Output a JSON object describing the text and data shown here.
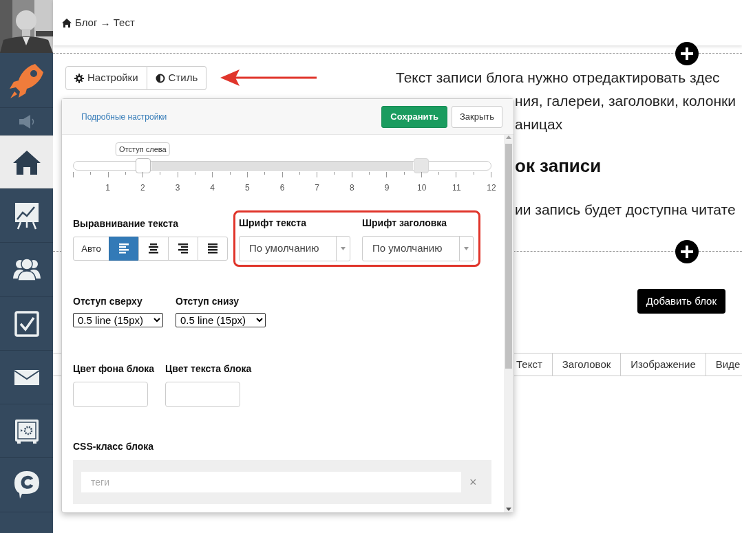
{
  "sidebar": {
    "items": [
      {
        "kind": "rocket",
        "selected": false
      },
      {
        "kind": "speaker",
        "selected": false
      },
      {
        "kind": "home",
        "selected": true
      },
      {
        "kind": "chart",
        "selected": false
      },
      {
        "kind": "people",
        "selected": false
      },
      {
        "kind": "checkbox",
        "selected": false
      },
      {
        "kind": "mail",
        "selected": false
      },
      {
        "kind": "safe",
        "selected": false
      },
      {
        "kind": "chat",
        "selected": false
      }
    ]
  },
  "breadcrumb": "Блог → Тест",
  "toolbar": {
    "buttons": [
      {
        "kind": "settings",
        "label": "Настройки"
      },
      {
        "kind": "style",
        "label": "Стиль"
      }
    ]
  },
  "content": {
    "lines": [
      "Текст записи блога нужно отредактировать здес",
      "ния, галереи, заголовки, колонки",
      "аницах"
    ],
    "heading": "ок записи",
    "paragraph": "ии запись будет доступна читате",
    "add_block_button": "Добавить блок",
    "block_types": [
      "Текст",
      "Заголовок",
      "Изображение",
      "Виде"
    ]
  },
  "popup": {
    "link": "Подробные настройки",
    "save_button": "Сохранить",
    "close_button": "Закрыть",
    "slider": {
      "tooltip": "Отступ слева",
      "ticks": [
        "1",
        "2",
        "3",
        "4",
        "5",
        "6",
        "7",
        "8",
        "9",
        "10",
        "11",
        "12"
      ],
      "thumbs": [
        {
          "level": 0.1667
        },
        {
          "level": 0.8333
        }
      ]
    },
    "alignment": {
      "label": "Выравнивание текста",
      "options": [
        {
          "kind": "auto",
          "label": "Авто",
          "selected": false
        },
        {
          "kind": "left",
          "selected": true
        },
        {
          "kind": "center",
          "selected": false
        },
        {
          "kind": "right",
          "selected": false
        },
        {
          "kind": "justify",
          "selected": false
        }
      ]
    },
    "fonts": [
      {
        "label": "Шрифт текста",
        "value": "По умолчанию"
      },
      {
        "label": "Шрифт заголовка",
        "value": "По умолчанию"
      }
    ],
    "spacing": [
      {
        "label": "Отступ сверху",
        "value": "0.5 line (15px)"
      },
      {
        "label": "Отступ снизу",
        "value": "0.5 line (15px)"
      }
    ],
    "colors": [
      {
        "label": "Цвет фона блока"
      },
      {
        "label": "Цвет текста блока"
      }
    ],
    "css_class": {
      "label": "CSS-класс блока",
      "placeholder": "теги",
      "clear": "×"
    }
  }
}
